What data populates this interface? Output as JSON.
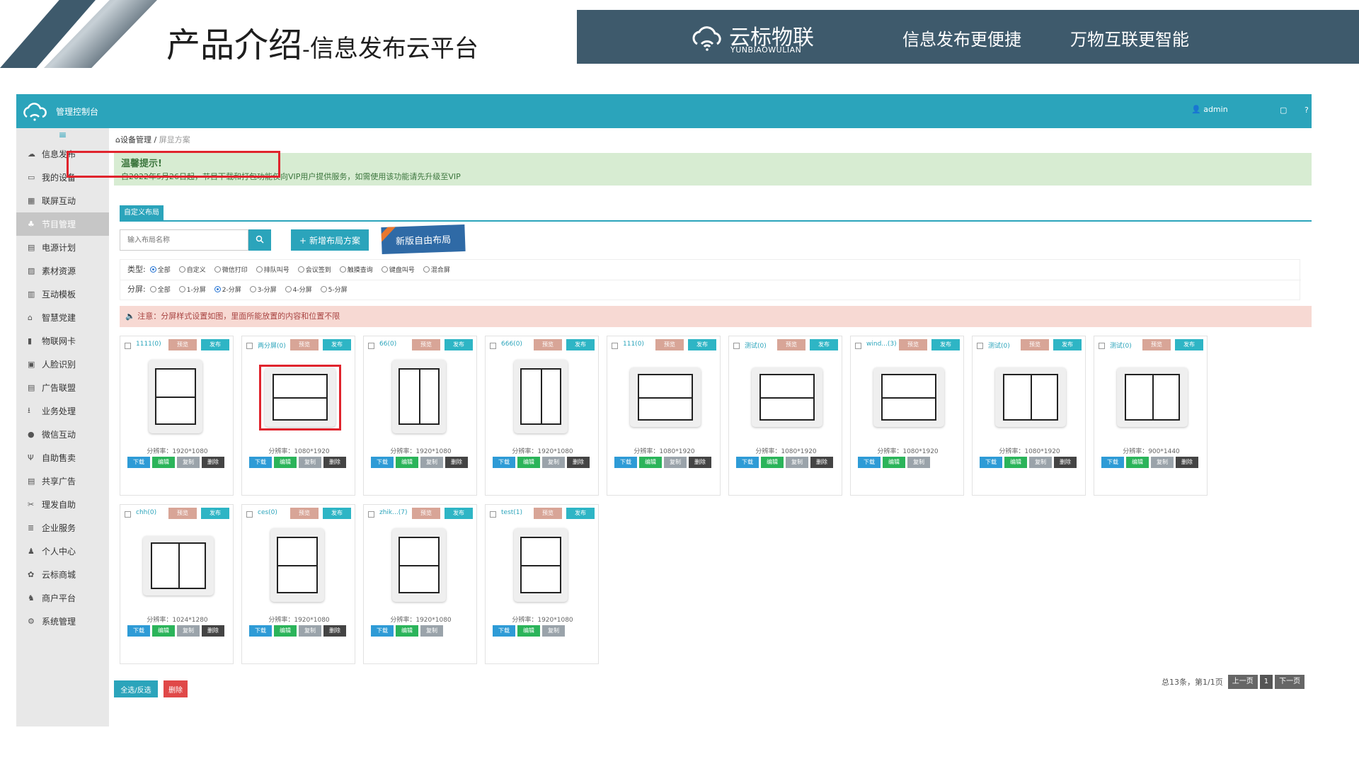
{
  "slide": {
    "title": "产品介绍",
    "separator": "-",
    "subtitle": "信息发布云平台",
    "brand_cn": "云标物联",
    "brand_en": "YUNBIAOWULIAN",
    "slogan1": "信息发布更便捷",
    "slogan2": "万物互联更智能",
    "banner_color": "#3e5a6c"
  },
  "topbar": {
    "title": "管理控制台",
    "user": "admin",
    "accent": "#2ba4bb"
  },
  "sidebar": {
    "items": [
      {
        "label": "信息发布",
        "icon": "cloud-icon"
      },
      {
        "label": "我的设备",
        "icon": "printer-icon"
      },
      {
        "label": "联屏互动",
        "icon": "grid-icon"
      },
      {
        "label": "节目管理",
        "icon": "sitemap-icon",
        "active": true
      },
      {
        "label": "电源计划",
        "icon": "calendar-icon"
      },
      {
        "label": "素材资源",
        "icon": "image-icon"
      },
      {
        "label": "互动模板",
        "icon": "columns-icon"
      },
      {
        "label": "智慧党建",
        "icon": "home-icon"
      },
      {
        "label": "物联网卡",
        "icon": "signal-icon"
      },
      {
        "label": "人脸识别",
        "icon": "photo-icon"
      },
      {
        "label": "广告联盟",
        "icon": "calendar-icon"
      },
      {
        "label": "业务处理",
        "icon": "download-icon"
      },
      {
        "label": "微信互动",
        "icon": "chat-icon"
      },
      {
        "label": "自助售卖",
        "icon": "cutlery-icon"
      },
      {
        "label": "共享广告",
        "icon": "calendar-icon"
      },
      {
        "label": "理发自助",
        "icon": "scissors-icon"
      },
      {
        "label": "企业服务",
        "icon": "list-icon"
      },
      {
        "label": "个人中心",
        "icon": "user-icon"
      },
      {
        "label": "云标商城",
        "icon": "gift-icon"
      },
      {
        "label": "商户平台",
        "icon": "users-icon"
      },
      {
        "label": "系统管理",
        "icon": "gear-icon"
      }
    ]
  },
  "breadcrumb": {
    "root": "设备管理",
    "sep": "/",
    "current": "屏显方案"
  },
  "tip": {
    "title": "温馨提示!",
    "text": "自2022年5月26日起，节目下载和打包功能仅向VIP用户提供服务，如需使用该功能请先升级至VIP"
  },
  "tab": {
    "label": "自定义布局"
  },
  "toolbar": {
    "search_placeholder": "输入布局名称",
    "add_label": "新增布局方案",
    "free_label": "新版自由布局"
  },
  "filters": {
    "type_label": "类型:",
    "type_options": [
      "全部",
      "自定义",
      "微信打印",
      "排队叫号",
      "会议签到",
      "触摸查询",
      "键盘叫号",
      "混合屏"
    ],
    "type_selected": 0,
    "split_label": "分屏:",
    "split_options": [
      "全部",
      "1-分屏",
      "2-分屏",
      "3-分屏",
      "4-分屏",
      "5-分屏"
    ],
    "split_selected": 2
  },
  "notice": "注意：分屏样式设置如图，里面所能放置的内容和位置不限",
  "card_actions": {
    "preview": "预览",
    "publish": "发布",
    "download": "下载",
    "edit": "编辑",
    "copy": "复制",
    "delete": "删除"
  },
  "cards": [
    {
      "name": "1111(0)",
      "res": "分辨率：1920*1080",
      "orient": "portrait",
      "split": "h",
      "del": true
    },
    {
      "name": "两分屏(0)",
      "res": "分辨率：1080*1920",
      "orient": "landscape",
      "split": "h",
      "del": true
    },
    {
      "name": "66(0)",
      "res": "分辨率：1920*1080",
      "orient": "portrait",
      "split": "v",
      "del": true
    },
    {
      "name": "666(0)",
      "res": "分辨率：1920*1080",
      "orient": "portrait",
      "split": "v",
      "del": true
    },
    {
      "name": "111(0)",
      "res": "分辨率：1080*1920",
      "orient": "landscape",
      "split": "h",
      "del": true
    },
    {
      "name": "测试(0)",
      "res": "分辨率：1080*1920",
      "orient": "landscape",
      "split": "h",
      "del": true
    },
    {
      "name": "wind...(3)",
      "res": "分辨率：1080*1920",
      "orient": "landscape",
      "split": "h",
      "del": false
    },
    {
      "name": "测试(0)",
      "res": "分辨率：1080*1920",
      "orient": "landscape",
      "split": "v",
      "del": true
    },
    {
      "name": "测试(0)",
      "res": "分辨率：900*1440",
      "orient": "landscape",
      "split": "v",
      "del": true
    },
    {
      "name": "chh(0)",
      "res": "分辨率：1024*1280",
      "orient": "landscape",
      "split": "v",
      "del": true
    },
    {
      "name": "ces(0)",
      "res": "分辨率：1920*1080",
      "orient": "portrait",
      "split": "h",
      "del": true
    },
    {
      "name": "zhik...(7)",
      "res": "分辨率：1920*1080",
      "orient": "portrait",
      "split": "h",
      "del": false
    },
    {
      "name": "test(1)",
      "res": "分辨率：1920*1080",
      "orient": "portrait",
      "split": "h",
      "del": false
    }
  ],
  "bottom": {
    "select_all": "全选/反选",
    "delete": "删除"
  },
  "pager": {
    "info": "总13条，第1/1页",
    "prev": "上一页",
    "page": "1",
    "next": "下一页"
  }
}
